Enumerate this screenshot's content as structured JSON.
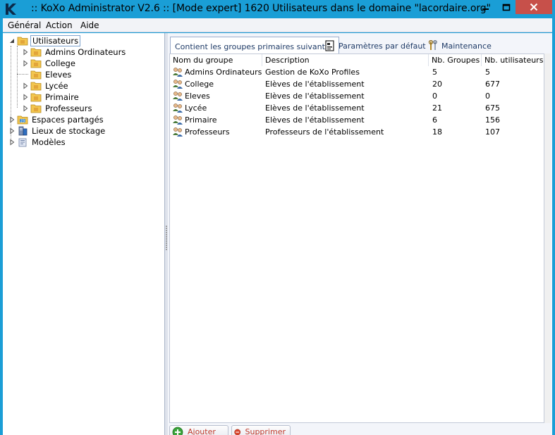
{
  "window": {
    "title": ":: KoXo Administrator V2.6 :: [Mode expert] 1620 Utilisateurs dans le domaine \"lacordaire.org\"",
    "accent_color": "#1a9ed6",
    "close_color": "#c7504a"
  },
  "menu": [
    {
      "label": "Général"
    },
    {
      "label": "Action"
    },
    {
      "label": "Aide"
    }
  ],
  "tree": {
    "root": {
      "label": "Utilisateurs",
      "expanded": true,
      "selected": true
    },
    "children": [
      {
        "label": "Admins Ordinateurs"
      },
      {
        "label": "College"
      },
      {
        "label": "Eleves"
      },
      {
        "label": "Lycée"
      },
      {
        "label": "Primaire"
      },
      {
        "label": "Professeurs"
      }
    ],
    "other_roots": [
      {
        "label": "Espaces partagés",
        "icon": "share-icon"
      },
      {
        "label": "Lieux de stockage",
        "icon": "storage-icon"
      },
      {
        "label": "Modèles",
        "icon": "template-icon"
      }
    ]
  },
  "tabs": [
    {
      "label": "Contient les groupes primaires suivants :",
      "active": true
    },
    {
      "label": "Paramètres par défaut",
      "icon": "settings-doc-icon"
    },
    {
      "label": "Maintenance",
      "icon": "tools-icon"
    }
  ],
  "table": {
    "columns": [
      "Nom du groupe",
      "Description",
      "Nb. Groupes",
      "Nb. utilisateurs"
    ],
    "rows": [
      {
        "name": "Admins Ordinateurs",
        "description": "Gestion de KoXo Profiles",
        "groups": "5",
        "users": "5"
      },
      {
        "name": "College",
        "description": "Elèves de l'établissement",
        "groups": "20",
        "users": "677"
      },
      {
        "name": "Eleves",
        "description": "Elèves de l'établissement",
        "groups": "0",
        "users": "0"
      },
      {
        "name": "Lycée",
        "description": "Elèves de l'établissement",
        "groups": "21",
        "users": "675"
      },
      {
        "name": "Primaire",
        "description": "Elèves de l'établissement",
        "groups": "6",
        "users": "156"
      },
      {
        "name": "Professeurs",
        "description": "Professeurs de l'établissement",
        "groups": "18",
        "users": "107"
      }
    ]
  },
  "buttons": {
    "add_label": "Ajouter",
    "delete_label": "Supprimer"
  }
}
